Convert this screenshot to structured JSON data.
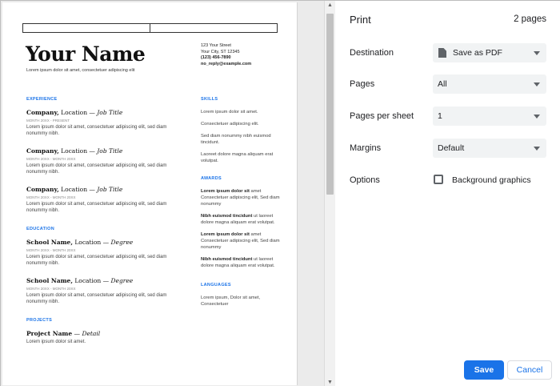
{
  "resume": {
    "name": "Your Name",
    "tagline": "Lorem ipsum dolor sit amet, consectetuer adipiscing elit",
    "address": {
      "street": "123 Your Street",
      "city": "Your City, ST 12345",
      "phone": "(123) 456-7890",
      "email": "no_reply@example.com"
    },
    "sections": {
      "experience": "EXPERIENCE",
      "education": "EDUCATION",
      "projects": "PROJECTS",
      "skills": "SKILLS",
      "awards": "AWARDS",
      "languages": "LANGUAGES"
    },
    "jobs": [
      {
        "company": "Company,",
        "location": " Location — ",
        "title": "Job Title",
        "date": "MONTH 20XX - PRESENT",
        "desc": "Lorem ipsum dolor sit amet, consectetuer adipiscing elit, sed diam nonummy nibh."
      },
      {
        "company": "Company,",
        "location": " Location — ",
        "title": "Job Title",
        "date": "MONTH 20XX - MONTH 20XX",
        "desc": "Lorem ipsum dolor sit amet, consectetuer adipiscing elit, sed diam nonummy nibh."
      },
      {
        "company": "Company,",
        "location": " Location — ",
        "title": "Job Title",
        "date": "MONTH 20XX - MONTH 20XX",
        "desc": "Lorem ipsum dolor sit amet, consectetuer adipiscing elit, sed diam nonummy nibh."
      }
    ],
    "schools": [
      {
        "school": "School Name,",
        "location": " Location — ",
        "degree": "Degree",
        "date": "MONTH 20XX - MONTH 20XX",
        "desc": "Lorem ipsum dolor sit amet, consectetuer adipiscing elit, sed diam nonummy nibh."
      },
      {
        "school": "School Name,",
        "location": " Location — ",
        "degree": "Degree",
        "date": "MONTH 20XX - MONTH 20XX",
        "desc": "Lorem ipsum dolor sit amet, consectetuer adipiscing elit, sed diam nonummy nibh."
      }
    ],
    "project": {
      "name": "Project Name",
      "sep": " — ",
      "detail": "Detail",
      "desc": "Lorem ipsum dolor sit amet."
    },
    "skills": [
      "Lorem ipsum dolor sit amet.",
      "Consectetuer adipiscing elit.",
      "Sed diam nonummy nibh euismod tincidunt.",
      "Laoreet dolore magna aliquam erat volutpat."
    ],
    "awards": [
      {
        "bold": "Lorem ipsum dolor sit",
        "rest": " amet Consectetuer adipiscing elit, Sed diam nonummy"
      },
      {
        "bold": "Nibh euismod tincidunt",
        "rest": " ut laoreet dolore magna aliquam erat volutpat."
      },
      {
        "bold": "Lorem ipsum dolor sit",
        "rest": " amet Consectetuer adipiscing elit, Sed diam nonummy"
      },
      {
        "bold": "Nibh euismod tincidunt",
        "rest": " ut laoreet dolore magna aliquam erat volutpat."
      }
    ],
    "languages": "Lorem ipsum, Dolor sit amet, Consectetuer"
  },
  "panel": {
    "title": "Print",
    "sheet_count": "2 pages",
    "rows": {
      "destination": {
        "label": "Destination",
        "value": "Save as PDF"
      },
      "pages": {
        "label": "Pages",
        "value": "All"
      },
      "pages_per_sheet": {
        "label": "Pages per sheet",
        "value": "1"
      },
      "margins": {
        "label": "Margins",
        "value": "Default"
      },
      "options": {
        "label": "Options",
        "checkbox_label": "Background graphics"
      }
    },
    "save_label": "Save",
    "cancel_label": "Cancel"
  }
}
